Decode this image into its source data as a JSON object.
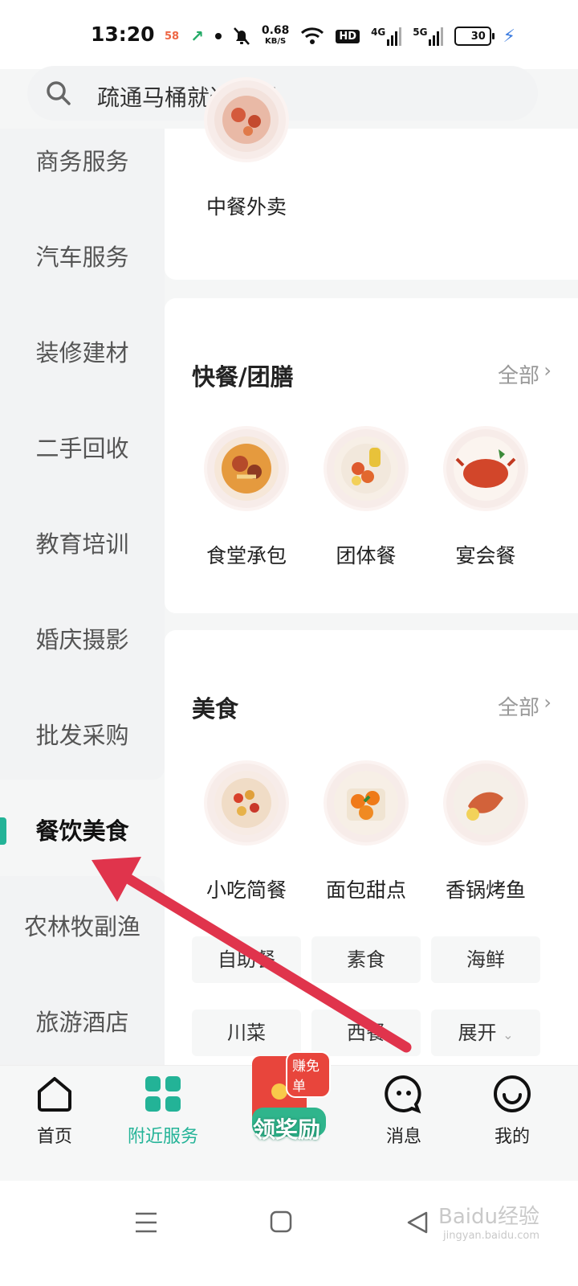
{
  "status_bar": {
    "time": "13:20",
    "app_58": "58",
    "net_speed": "0.68",
    "net_unit": "KB/S",
    "hd_label": "HD",
    "sig1": "4G",
    "sig2": "5G",
    "battery": "30"
  },
  "search": {
    "placeholder": "疏通马桶就近上门"
  },
  "sidebar": {
    "items": [
      {
        "label": "商务服务"
      },
      {
        "label": "汽车服务"
      },
      {
        "label": "装修建材"
      },
      {
        "label": "二手回收"
      },
      {
        "label": "教育培训"
      },
      {
        "label": "婚庆摄影"
      },
      {
        "label": "批发采购"
      },
      {
        "label": "餐饮美食",
        "active": true
      },
      {
        "label": "农林牧副渔"
      },
      {
        "label": "旅游酒店"
      }
    ]
  },
  "sections": {
    "top": {
      "categories": [
        {
          "label": "中餐外卖"
        }
      ]
    },
    "fast": {
      "title": "快餐/团膳",
      "more": "全部",
      "categories": [
        {
          "label": "食堂承包"
        },
        {
          "label": "团体餐"
        },
        {
          "label": "宴会餐"
        }
      ]
    },
    "food": {
      "title": "美食",
      "more": "全部",
      "categories": [
        {
          "label": "小吃简餐"
        },
        {
          "label": "面包甜点"
        },
        {
          "label": "香锅烤鱼"
        }
      ],
      "chips": [
        "自助餐",
        "素食",
        "海鲜",
        "川菜",
        "西餐",
        "展开"
      ]
    }
  },
  "tabbar": {
    "items": [
      {
        "label": "首页"
      },
      {
        "label": "附近服务",
        "active": true
      },
      {
        "label": "领奖励",
        "badge": "赚免单"
      },
      {
        "label": "消息"
      },
      {
        "label": "我的"
      }
    ]
  },
  "watermark": {
    "text": "Baidu经验",
    "sub": "jingyan.baidu.com"
  },
  "colors": {
    "accent": "#23b397",
    "arrow": "#e0344c",
    "promo": "#e8453c"
  }
}
